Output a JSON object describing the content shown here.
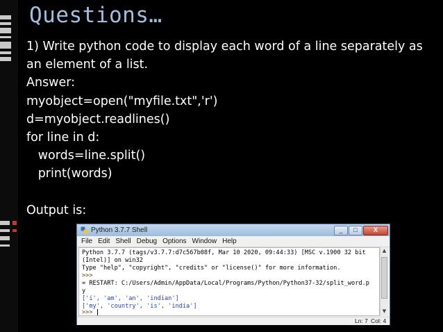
{
  "slide": {
    "title": "Questions…",
    "lines": [
      "1) Write python code to display each word of a line separately as an element of a list.",
      "Answer:",
      "myobject=open(\"myfile.txt\",'r')",
      "d=myobject.readlines()",
      "for line in d:",
      "   words=line.split()",
      "   print(words)",
      "",
      "Output is:"
    ]
  },
  "shell": {
    "window_title": "Python 3.7.7 Shell",
    "window_buttons": {
      "minimize": "_",
      "maximize": "□",
      "close": "X"
    },
    "menu": [
      "File",
      "Edit",
      "Shell",
      "Debug",
      "Options",
      "Window",
      "Help"
    ],
    "console": [
      "Python 3.7.7 (tags/v3.7.7:d7c567b08f, Mar 10 2020, 09:44:33) [MSC v.1900 32 bit",
      "(Intel)] on win32",
      "Type \"help\", \"copyright\", \"credits\" or \"license()\" for more information.",
      ">>>",
      "= RESTART: C:/Users/Admin/AppData/Local/Programs/Python/Python37-32/split_word.p",
      "y",
      "['i', 'am', 'an', 'indian']",
      "['my', 'country', 'is', 'india']",
      ">>> "
    ],
    "status": {
      "line": "Ln: 7",
      "col": "Col: 4"
    }
  },
  "colors": {
    "title": "#9fbfe2",
    "background": "#000000",
    "output_text": "#1f3fd6",
    "prompt_text": "#7a3d00"
  }
}
